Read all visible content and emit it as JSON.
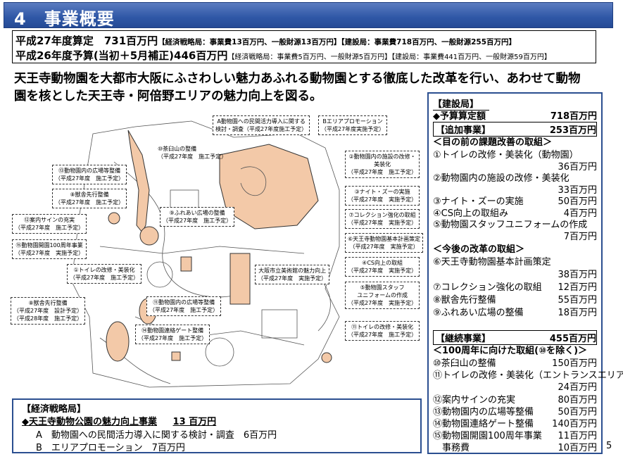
{
  "header": {
    "title": "4　事業概要"
  },
  "budget": {
    "line1": {
      "main": "平成27年度算定　731百万円",
      "detail": "【経済戦略局：事業費13百万円、一般財源13百万円】【建設局：事業費718百万円、一般財源255百万円】"
    },
    "line2": {
      "main": "平成26年度予算(当初＋5月補正)446百万円",
      "detail": "【経済戦略局：事業費5百万円、一般財源5百万円】【建設局：事業費441百万円、一般財源59百万円】"
    }
  },
  "lead": {
    "line1": "天王寺動物園を大都市大阪にふさわしい魅力あふれる動物園とする徹底した改革を行い、あわせて動物",
    "line2": "園を核とした天王寺・阿倍野エリアの魅力向上を図る。"
  },
  "map": {
    "labels": {
      "a": [
        "A動物園への民間活力導入に関する",
        "検討・調査（平成27年度施工予定）"
      ],
      "b": [
        "Bエリアプロモーション",
        "（平成27年度実施予定）"
      ],
      "chausu": [
        "⑩茶臼山の整備",
        "（平成27年度　施工予定）"
      ],
      "hiroba13": [
        "⑬動物園内の広場等整備",
        "（平成27年度　施工予定）"
      ],
      "kansha8": [
        "⑧獣舎先行整備",
        "（平成27年度　施工予定）"
      ],
      "sign12": [
        "⑫案内サインの充実",
        "（平成27年度　施工予定）"
      ],
      "fureai9": [
        "⑨ふれあい広場の整備",
        "（平成27年度　施工予定）"
      ],
      "kaien15": [
        "⑮動物園開園100周年事業",
        "（平成27年度　実施予定）"
      ],
      "toilet1": [
        "①トイレの改修・美装化",
        "（平成27年度　施工予定）"
      ],
      "kansha8b": [
        "⑧獣舎先行整備",
        "（平成27年度　設計予定）",
        "（平成28年度　施工予定）"
      ],
      "hiroba11": [
        "⑪動物園内の広場等整備",
        "（平成27年度　施工予定）"
      ],
      "gate14": [
        "⑭動物園連絡ゲート整備",
        "（平成27年度　施工予定）"
      ],
      "museum": [
        "大阪市立美術館の魅力向上",
        "（平成27年度　実施予定）"
      ],
      "shisetsu2": [
        "②動物園内の施設の改修・",
        "美装化",
        "（平成27年度　施工予定）"
      ],
      "night3": [
        "③ナイト・ズーの実施",
        "（平成27年度　実施予定）"
      ],
      "collection7": [
        "⑦コレクション強化の取組",
        "（平成27年度　実施予定）"
      ],
      "keikaku6": [
        "⑥天王寺動物園基本計画策定",
        "（平成27年度　実施予定）"
      ],
      "cs4": [
        "④CS向上の取組",
        "（平成27年度　実施予定）"
      ],
      "staff5": [
        "⑤動物園スタッフ",
        "ユニフォームの作成",
        "（平成27年度　実施予定）"
      ],
      "toilet11": [
        "⑪トイレの改修・美装化",
        "（平成27年度　施工予定）"
      ]
    }
  },
  "right_panel": {
    "kensetsu_head": "【建設局】",
    "kensetsu_total": {
      "label": "◆予算算定額",
      "amount": "718百万円"
    },
    "tsuika_head": {
      "label": "【追加事業】",
      "amount": "253百万円"
    },
    "mae_head": "＜目の前の課題改善の取組＞",
    "mae_items": [
      {
        "label": "①トイレの改修・美装化（動物園）",
        "amount": ""
      },
      {
        "label": "",
        "amount": "36百万円"
      },
      {
        "label": "②動物園内の施設の改修・美装化",
        "amount": ""
      },
      {
        "label": "",
        "amount": "33百万円"
      },
      {
        "label": "③ナイト・ズーの実施",
        "amount": "50百万円"
      },
      {
        "label": "④CS向上の取組み",
        "amount": "4百万円"
      },
      {
        "label": "⑤動物園スタッフユニフォームの作成",
        "amount": ""
      },
      {
        "label": "",
        "amount": "7百万円"
      }
    ],
    "kongo_head": "＜今後の改革の取組＞",
    "kongo_items": [
      {
        "label": "⑥天王寺動物園基本計画策定",
        "amount": ""
      },
      {
        "label": "",
        "amount": "38百万円"
      },
      {
        "label": "⑦コレクション強化の取組",
        "amount": "12百万円"
      },
      {
        "label": "⑧獣舎先行整備",
        "amount": "55百万円"
      },
      {
        "label": "⑨ふれあい広場の整備",
        "amount": "18百万円"
      }
    ],
    "keizoku_head": {
      "label": "【継続事業】",
      "amount": "455百万円"
    },
    "shunen_head": "＜100周年に向けた取組(⑩を除く)＞",
    "shunen_items": [
      {
        "label": "⑩茶臼山の整備",
        "amount": "150百万円"
      },
      {
        "label": "⑪トイレの改修・美装化（エントランスエリア）",
        "amount": ""
      },
      {
        "label": "",
        "amount": "24百万円"
      },
      {
        "label": "⑫案内サインの充実",
        "amount": "80百万円"
      },
      {
        "label": "⑬動物園内の広場等整備",
        "amount": "50百万円"
      },
      {
        "label": "⑭動物園連絡ゲート整備",
        "amount": "140百万円"
      },
      {
        "label": "⑮動物園開園100周年事業",
        "amount": "11百万円"
      },
      {
        "label": "　事務費",
        "amount": "10百万円"
      }
    ]
  },
  "bottom": {
    "head": "【経済戦略局】",
    "main": {
      "label": "◆天王寺動物公園の魅力向上事業",
      "amount": "13 百万円"
    },
    "a": "A　動物園への民間活力導入に関する検討・調査　6百万円",
    "b": "B　エリアプロモーション　7百万円"
  },
  "page_number": "5",
  "colors": {
    "title_bar": "#2f57a6",
    "panel_border": "#2b4f90",
    "highlight_fill": "#f3c9a8"
  }
}
